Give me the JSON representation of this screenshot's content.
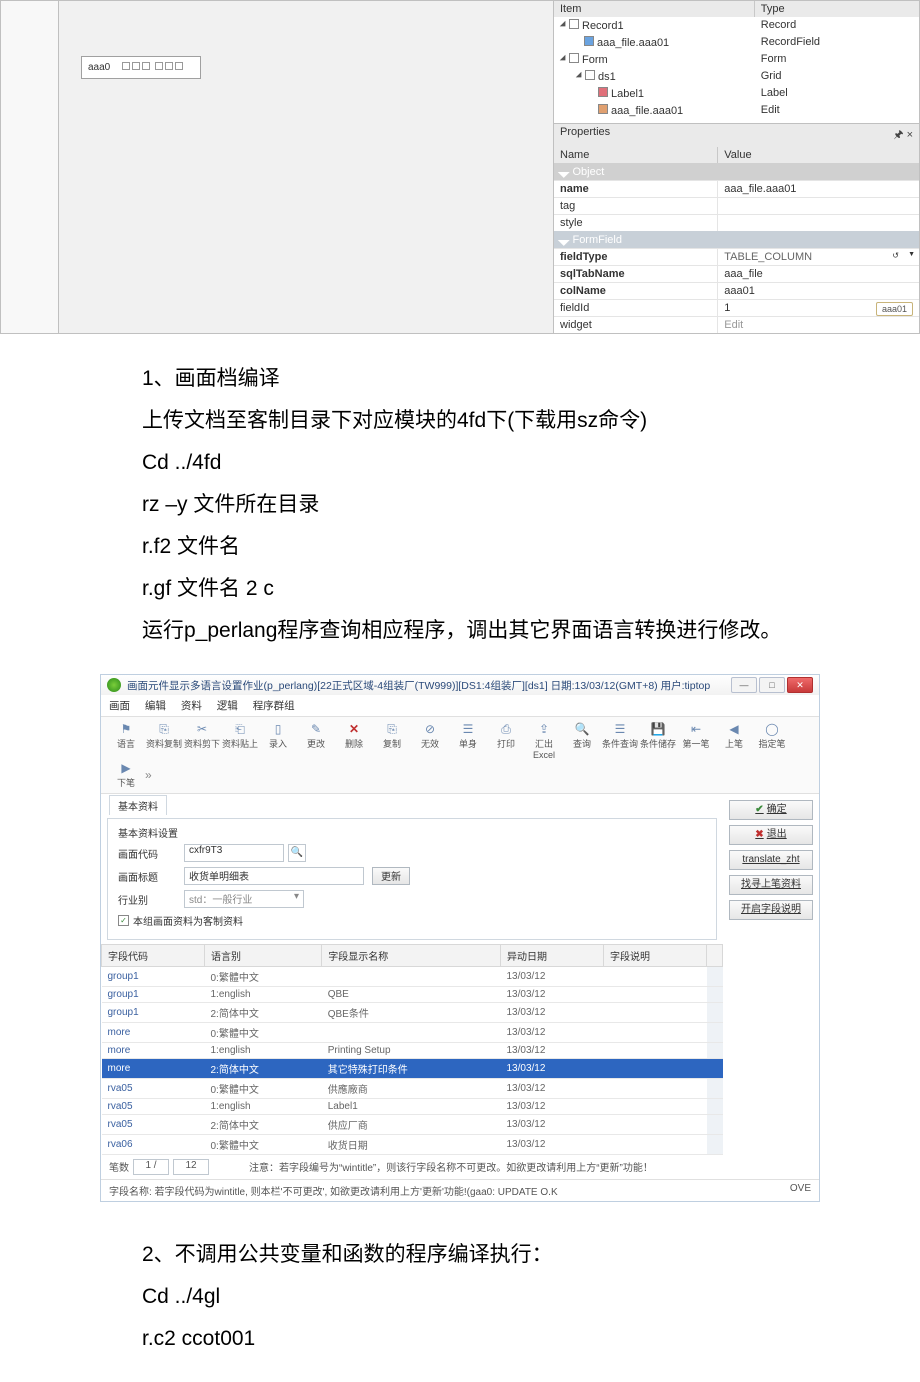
{
  "fig1": {
    "tree_header": {
      "item": "Item",
      "type": "Type"
    },
    "tree": [
      {
        "indent": 0,
        "label": "Record1",
        "type": "Record"
      },
      {
        "indent": 1,
        "label": "aaa_file.aaa01",
        "type": "RecordField"
      },
      {
        "indent": 0,
        "label": "Form",
        "type": "Form"
      },
      {
        "indent": 1,
        "label": "ds1",
        "type": "Grid"
      },
      {
        "indent": 2,
        "label": "Label1",
        "type": "Label"
      },
      {
        "indent": 2,
        "label": "aaa_file.aaa01",
        "type": "Edit"
      }
    ],
    "props_title": "Properties",
    "props_header": {
      "name": "Name",
      "value": "Value"
    },
    "groups": {
      "object": "Object",
      "formfield": "FormField"
    },
    "props": {
      "name_l": "name",
      "name_v": "aaa_file.aaa01",
      "tag_l": "tag",
      "tag_v": "",
      "style_l": "style",
      "style_v": "",
      "fieldType_l": "fieldType",
      "fieldType_v": "TABLE_COLUMN",
      "sqlTabName_l": "sqlTabName",
      "sqlTabName_v": "aaa_file",
      "colName_l": "colName",
      "colName_v": "aaa01",
      "fieldId_l": "fieldId",
      "fieldId_v": "1",
      "widget_l": "widget",
      "widget_v": "Edit"
    },
    "element_label": "aaa0",
    "badge": "aaa01"
  },
  "text": {
    "p1": "1、画面档编译",
    "p2": "上传文档至客制目录下对应模块的4fd下(下载用sz命令)",
    "p3": "Cd ../4fd",
    "p4": "rz –y 文件所在目录",
    "p5": "r.f2 文件名",
    "p6": "r.gf 文件名 2 c",
    "p7": "运行p_perlang程序查询相应程序，调出其它界面语言转换进行修改。",
    "p8": "2、不调用公共变量和函数的程序编译执行：",
    "p9": "Cd ../4gl",
    "p10": "r.c2 ccot001"
  },
  "fig2": {
    "title": "画面元件显示多语言设置作业(p_perlang)[22正式区域-4组装厂(TW999)][DS1:4组装厂][ds1] 日期:13/03/12(GMT+8) 用户:tiptop",
    "menu": [
      "画面",
      "编辑",
      "资料",
      "逻辑",
      "程序群组"
    ],
    "toolbar": [
      {
        "ico": "⚑",
        "lbl": "语言"
      },
      {
        "ico": "⎘",
        "lbl": "资料复制"
      },
      {
        "ico": "✂",
        "lbl": "资料剪下"
      },
      {
        "ico": "⎗",
        "lbl": "资料贴上"
      },
      {
        "ico": "▯",
        "lbl": "录入"
      },
      {
        "ico": "✎",
        "lbl": "更改"
      },
      {
        "ico": "✕",
        "lbl": "删除",
        "del": true
      },
      {
        "ico": "⎘",
        "lbl": "复制"
      },
      {
        "ico": "⊘",
        "lbl": "无效"
      },
      {
        "ico": "☰",
        "lbl": "单身"
      },
      {
        "ico": "⎙",
        "lbl": "打印"
      },
      {
        "ico": "⇪",
        "lbl": "汇出Excel"
      },
      {
        "ico": "🔍",
        "lbl": "查询"
      },
      {
        "ico": "☰",
        "lbl": "条件查询"
      },
      {
        "ico": "💾",
        "lbl": "条件储存"
      },
      {
        "ico": "⇤",
        "lbl": "第一笔"
      },
      {
        "ico": "◀",
        "lbl": "上笔"
      },
      {
        "ico": "◯",
        "lbl": "指定笔"
      },
      {
        "ico": "▶",
        "lbl": "下笔"
      }
    ],
    "side_btns": {
      "ok": "确定",
      "quit": "退出",
      "translate": "translate_zht",
      "last": "找寻上笔资料",
      "openhelp": "开启字段说明"
    },
    "tab": "基本资料",
    "group_title": "基本资料设置",
    "form": {
      "code_lbl": "画面代码",
      "code_val": "cxfr9T3",
      "title_lbl": "画面标题",
      "title_val": "收货单明细表",
      "update_btn": "更新",
      "ind_lbl": "行业别",
      "ind_val": "std：一般行业",
      "chk_lbl": "本组画面资料为客制资料"
    },
    "cols": [
      "字段代码",
      "语言别",
      "字段显示名称",
      "异动日期",
      "字段说明"
    ],
    "rows": [
      {
        "c1": "group1",
        "c2": "0:繁體中文",
        "c3": "",
        "c4": "13/03/12",
        "c5": ""
      },
      {
        "c1": "group1",
        "c2": "1:english",
        "c3": "QBE",
        "c4": "13/03/12",
        "c5": ""
      },
      {
        "c1": "group1",
        "c2": "2:简体中文",
        "c3": "QBE条件",
        "c4": "13/03/12",
        "c5": ""
      },
      {
        "c1": "more",
        "c2": "0:繁體中文",
        "c3": "",
        "c4": "13/03/12",
        "c5": ""
      },
      {
        "c1": "more",
        "c2": "1:english",
        "c3": "Printing Setup",
        "c4": "13/03/12",
        "c5": ""
      },
      {
        "c1": "more",
        "c2": "2:简体中文",
        "c3": "其它特殊打印条件",
        "c4": "13/03/12",
        "c5": "",
        "hl": true
      },
      {
        "c1": "rva05",
        "c2": "0:繁體中文",
        "c3": "供應廠商",
        "c4": "13/03/12",
        "c5": ""
      },
      {
        "c1": "rva05",
        "c2": "1:english",
        "c3": "Label1",
        "c4": "13/03/12",
        "c5": ""
      },
      {
        "c1": "rva05",
        "c2": "2:简体中文",
        "c3": "供应厂商",
        "c4": "13/03/12",
        "c5": ""
      },
      {
        "c1": "rva06",
        "c2": "0:繁體中文",
        "c3": "收货日期",
        "c4": "13/03/12",
        "c5": ""
      }
    ],
    "footer": {
      "nav_lbl": "笔数",
      "nav_pos": "1  /",
      "nav_total": "12",
      "note": "注意：若字段编号为“wintitle”，则该行字段名称不可更改。如欲更改请利用上方“更新”功能！"
    },
    "status_l": "字段名称: 若字段代码为wintitle, 则本栏'不可更改', 如欲更改请利用上方'更新'功能!(gaa0: UPDATE O.K",
    "status_r": "OVE"
  }
}
